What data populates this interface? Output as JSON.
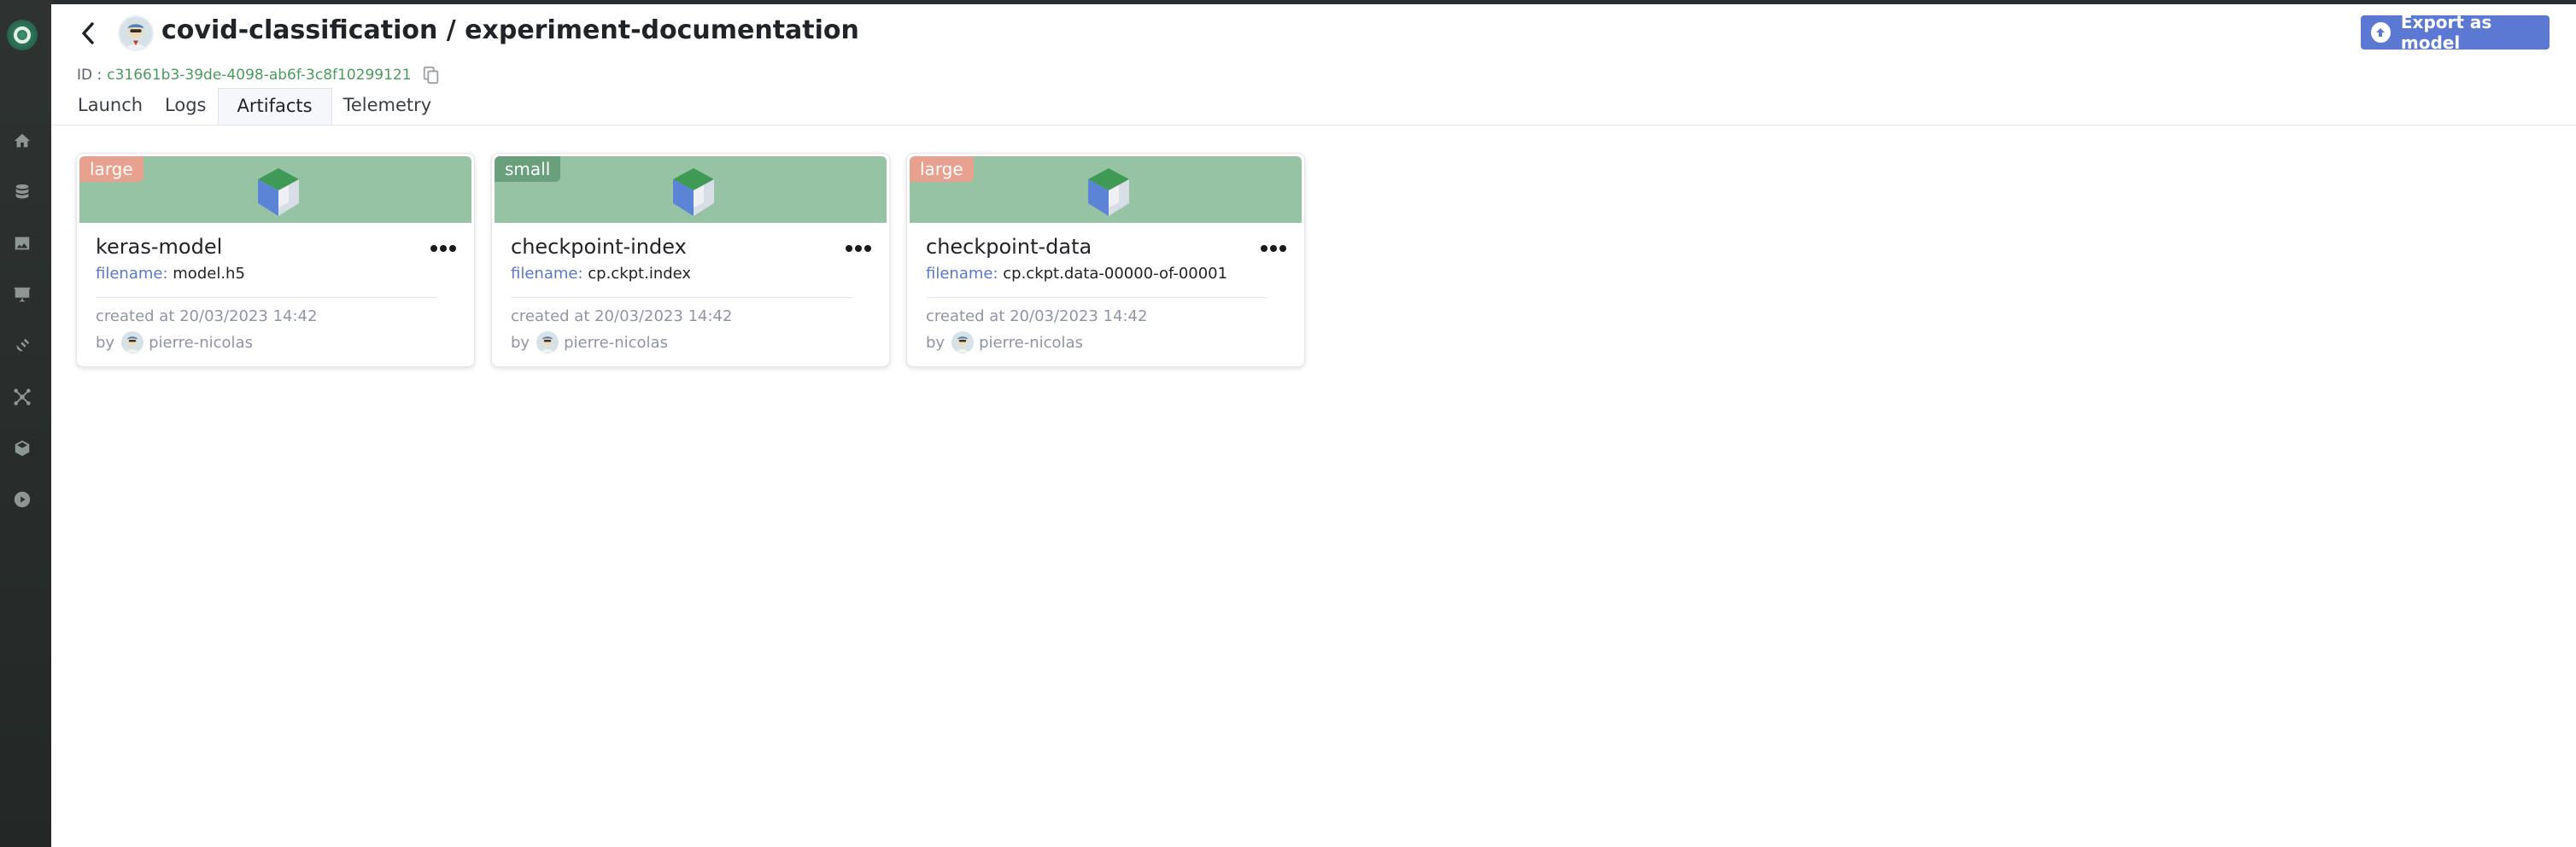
{
  "app": {
    "title": "covid-classification / experiment-documentation",
    "id_label": "ID :",
    "id_value": "c31661b3-39de-4098-ab6f-3c8f10299121",
    "export_button": "Export as model"
  },
  "sidebar": {
    "items": [
      {
        "icon": "home-icon"
      },
      {
        "icon": "database-icon"
      },
      {
        "icon": "image-icon"
      },
      {
        "icon": "presentation-icon"
      },
      {
        "icon": "satellite-icon"
      },
      {
        "icon": "network-icon"
      },
      {
        "icon": "cube-icon"
      },
      {
        "icon": "play-circle-icon"
      }
    ]
  },
  "tabs": [
    {
      "label": "Launch",
      "active": false
    },
    {
      "label": "Logs",
      "active": false
    },
    {
      "label": "Artifacts",
      "active": true
    },
    {
      "label": "Telemetry",
      "active": false
    }
  ],
  "cards": [
    {
      "badge": "large",
      "badge_color": "#e8a18f",
      "name": "keras-model",
      "filename_label": "filename:",
      "filename": "model.h5",
      "created": "created at 20/03/2023 14:42",
      "by_label": "by",
      "user": "pierre-nicolas"
    },
    {
      "badge": "small",
      "badge_color": "#6a9f7b",
      "name": "checkpoint-index",
      "filename_label": "filename:",
      "filename": "cp.ckpt.index",
      "created": "created at 20/03/2023 14:42",
      "by_label": "by",
      "user": "pierre-nicolas"
    },
    {
      "badge": "large",
      "badge_color": "#e8a18f",
      "name": "checkpoint-data",
      "filename_label": "filename:",
      "filename": "cp.ckpt.data-00000-of-00001",
      "created": "created at 20/03/2023 14:42",
      "by_label": "by",
      "user": "pierre-nicolas"
    }
  ],
  "colors": {
    "accent": "#5b79d2",
    "banner": "#96c3a4",
    "id_green": "#4b9a5e"
  }
}
